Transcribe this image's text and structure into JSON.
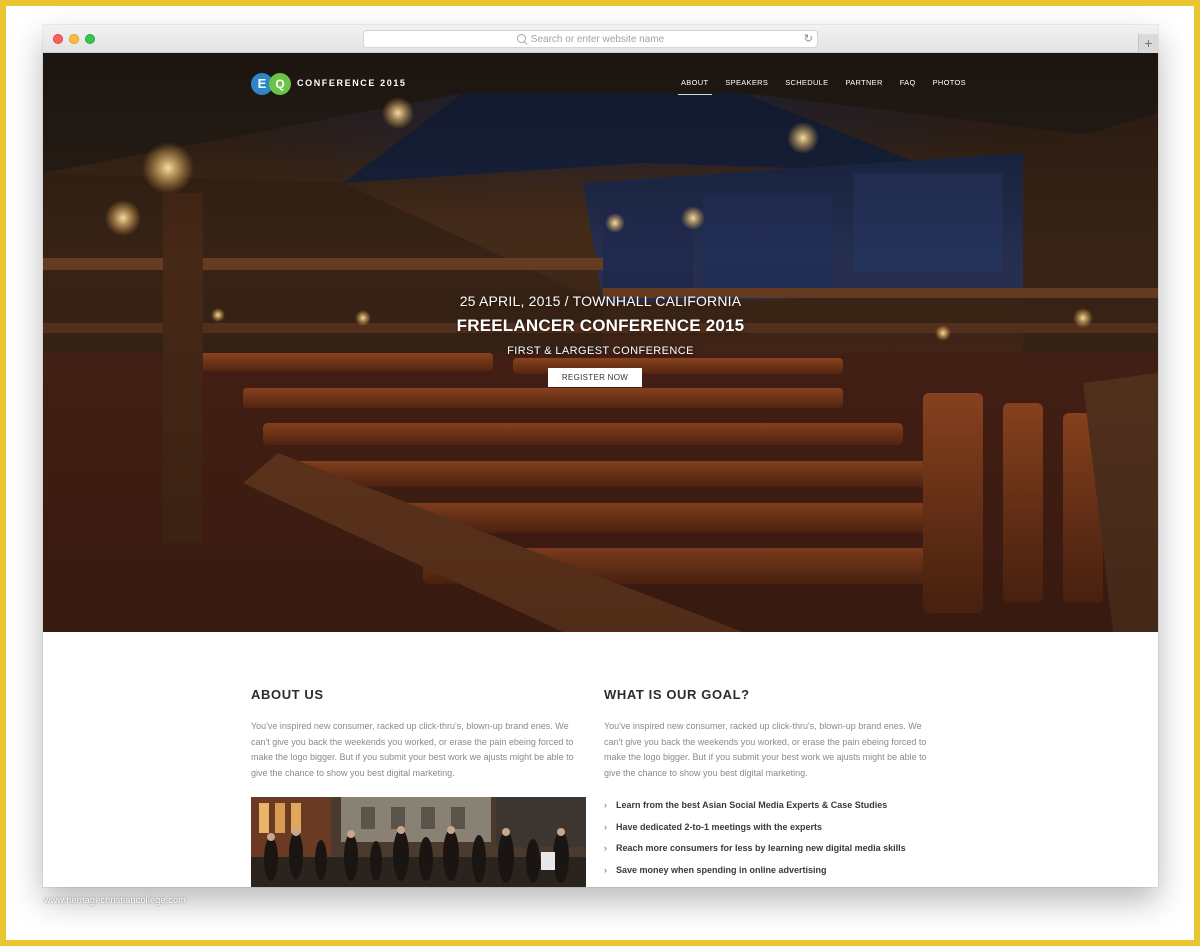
{
  "browser": {
    "url_placeholder": "Search or enter website name",
    "reload_icon": "reload-icon",
    "new_tab_label": "+"
  },
  "brand": {
    "logo_letter_1": "E",
    "logo_letter_2": "Q",
    "name": "CONFERENCE 2015",
    "colors": {
      "blue": "#2f86c7",
      "green": "#6ac44a"
    }
  },
  "nav": {
    "items": [
      {
        "label": "ABOUT",
        "active": true
      },
      {
        "label": "SPEAKERS"
      },
      {
        "label": "SCHEDULE"
      },
      {
        "label": "PARTNER"
      },
      {
        "label": "FAQ"
      },
      {
        "label": "PHOTOS"
      }
    ]
  },
  "hero": {
    "date_location": "25 APRIL, 2015 / TOWNHALL CALIFORNIA",
    "title": "FREELANCER CONFERENCE 2015",
    "subtitle": "FIRST & LARGEST CONFERENCE",
    "cta": "REGISTER NOW"
  },
  "about": {
    "heading": "ABOUT US",
    "body": "You've inspired new consumer, racked up click-thru's, blown-up brand enes. We can't give you back the weekends you worked, or erase the pain ebeing forced to make the logo bigger. But if you submit your best work we ajusts might be able to give the chance to show you best digital marketing."
  },
  "goal": {
    "heading": "WHAT IS OUR GOAL?",
    "body": "You've inspired new consumer, racked up click-thru's, blown-up brand enes. We can't give you back the weekends you worked, or erase the pain ebeing forced to make the logo bigger. But if you submit your best work we ajusts might be able to give the chance to show you best digital marketing.",
    "items": [
      "Learn from the best Asian Social Media Experts & Case Studies",
      "Have dedicated 2-to-1 meetings with the experts",
      "Reach more consumers for less by learning new digital media skills",
      "Save money when spending in online advertising"
    ]
  },
  "watermark": "www.heritagechristiancollege.com"
}
